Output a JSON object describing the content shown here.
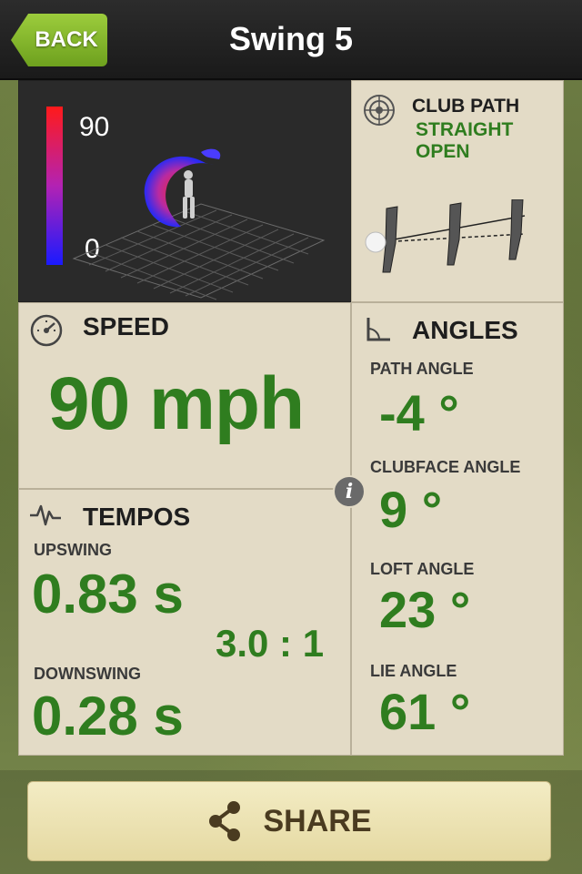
{
  "header": {
    "back_label": "BACK",
    "title": "Swing 5"
  },
  "visualization": {
    "scale_max": "90",
    "scale_min": "0",
    "colors": {
      "high": "#ff1a1a",
      "low": "#1a1aff"
    }
  },
  "club_path": {
    "title": "CLUB PATH",
    "line1": "STRAIGHT",
    "line2": "OPEN"
  },
  "speed": {
    "title": "SPEED",
    "value": "90 mph"
  },
  "tempos": {
    "title": "TEMPOS",
    "upswing_label": "UPSWING",
    "upswing_value": "0.83 s",
    "ratio": "3.0 : 1",
    "downswing_label": "DOWNSWING",
    "downswing_value": "0.28 s"
  },
  "angles": {
    "title": "ANGLES",
    "items": [
      {
        "label": "PATH ANGLE",
        "value": "-4 °"
      },
      {
        "label": "CLUBFACE ANGLE",
        "value": "9 °"
      },
      {
        "label": "LOFT ANGLE",
        "value": "23 °"
      },
      {
        "label": "LIE  ANGLE",
        "value": "61 °"
      }
    ]
  },
  "info_badge": "i",
  "share": {
    "label": "SHARE"
  },
  "theme": {
    "accent_green": "#2f7d1f",
    "panel_bg": "#e3dbc6",
    "back_green": "#7eb62a"
  }
}
